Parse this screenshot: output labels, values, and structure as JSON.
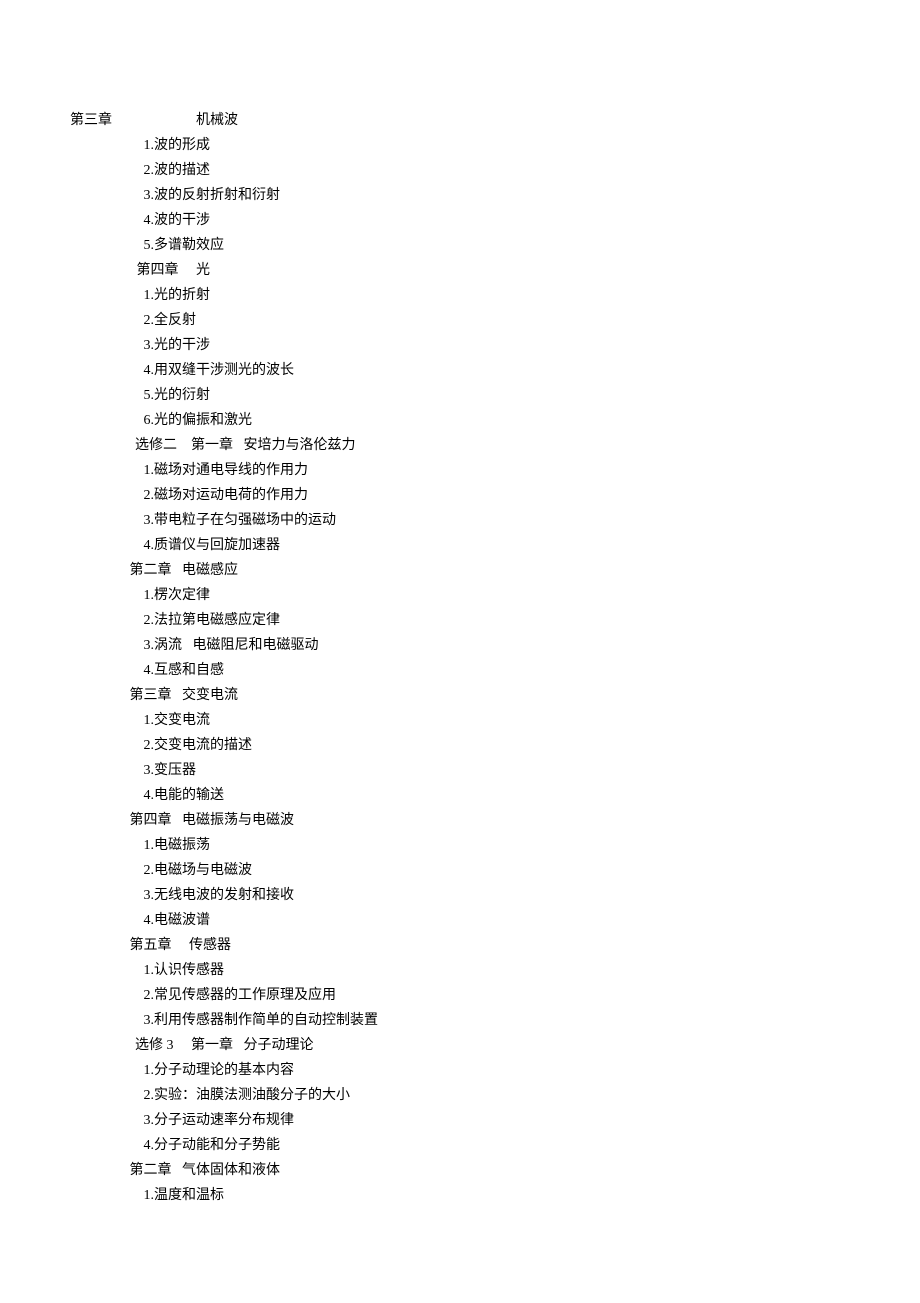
{
  "blocks": [
    {
      "label": "第三章",
      "label_style": "top",
      "title": "机械波",
      "title_pad": "                        ",
      "items": [
        "1.波的形成",
        "2.波的描述",
        "3.波的反射折射和衍射",
        "4.波的干涉",
        "5.多谱勒效应"
      ],
      "item_indent": "                     "
    },
    {
      "label": "",
      "title": "第四章     光",
      "title_pad": "                   ",
      "items": [
        "1.光的折射",
        "2.全反射",
        "3.光的干涉",
        "4.用双缝干涉测光的波长",
        "5.光的衍射",
        "6.光的偏振和激光"
      ],
      "item_indent": "                     "
    },
    {
      "label": "选修二",
      "label_style": "book",
      "title": "第一章   安培力与洛伦兹力",
      "title_pad": "    ",
      "items": [
        "1.磁场对通电导线的作用力",
        "2.磁场对运动电荷的作用力",
        "3.带电粒子在匀强磁场中的运动",
        "4.质谱仪与回旋加速器"
      ],
      "item_indent": "                     "
    },
    {
      "label": "",
      "title": "第二章   电磁感应",
      "title_pad": "                 ",
      "items": [
        "1.楞次定律",
        "2.法拉第电磁感应定律",
        "3.涡流   电磁阻尼和电磁驱动",
        "4.互感和自感"
      ],
      "item_indent": "                     "
    },
    {
      "label": "",
      "title": "第三章   交变电流",
      "title_pad": "                 ",
      "items": [
        "1.交变电流",
        "2.交变电流的描述",
        "3.变压器",
        "4.电能的输送"
      ],
      "item_indent": "                     "
    },
    {
      "label": "",
      "title": "第四章   电磁振荡与电磁波",
      "title_pad": "                 ",
      "items": [
        "1.电磁振荡",
        "2.电磁场与电磁波",
        "3.无线电波的发射和接收",
        "4.电磁波谱"
      ],
      "item_indent": "                     "
    },
    {
      "label": "",
      "title": "第五章     传感器",
      "title_pad": "                 ",
      "items": [
        "1.认识传感器",
        "2.常见传感器的工作原理及应用",
        "3.利用传感器制作简单的自动控制装置"
      ],
      "item_indent": "                     "
    },
    {
      "label": "选修 3",
      "label_style": "book",
      "title": "第一章   分子动理论",
      "title_pad": "     ",
      "items": [
        "1.分子动理论的基本内容",
        "2.实验：油膜法测油酸分子的大小",
        "3.分子运动速率分布规律",
        "4.分子动能和分子势能"
      ],
      "item_indent": "                     "
    },
    {
      "label": "",
      "title": "第二章   气体固体和液体",
      "title_pad": "                 ",
      "items": [
        "1.温度和温标"
      ],
      "item_indent": "                     "
    }
  ]
}
